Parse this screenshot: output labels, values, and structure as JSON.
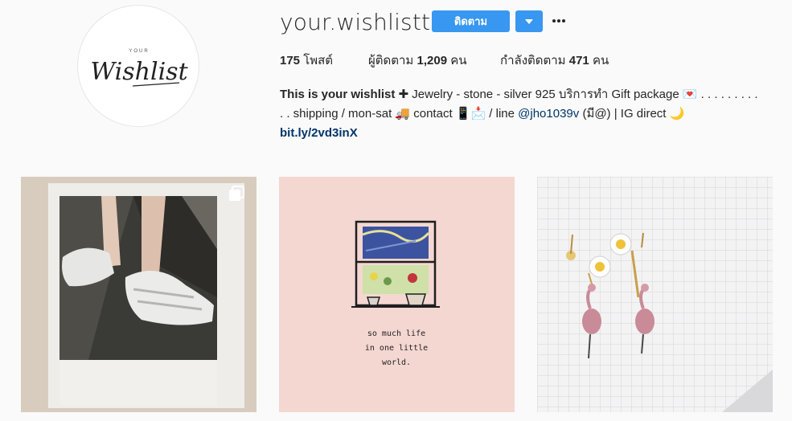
{
  "profile": {
    "username": "your.wishlistt",
    "avatar_text_small": "YOUR",
    "avatar_text_large": "Wishlist",
    "follow_label": "ติดตาม",
    "dropdown_icon": "caret-down-icon",
    "more_icon": "ellipsis-icon"
  },
  "stats": {
    "posts_count": "175",
    "posts_label": "โพสต์",
    "followers_label": "ผู้ติดตาม",
    "followers_count": "1,209",
    "followers_unit": "คน",
    "following_label": "กำลังติดตาม",
    "following_count": "471",
    "following_unit": "คน"
  },
  "bio": {
    "name": "This is your wishlist",
    "line1_rest": " ✚ Jewelry - stone - silver 925 บริการทำ Gift package 💌 . . . . . . . . .",
    "line2_pre": ". . shipping / mon-sat 🚚 contact 📱📩 / line ",
    "mention": "@jho1039v",
    "line2_post": " (มี@) | IG direct 🌙",
    "link": "bit.ly/2vd3inX"
  },
  "posts": [
    {
      "caption": "",
      "multi_icon": "carousel-icon"
    },
    {
      "caption_lines": [
        "so much life",
        "in one little",
        "world."
      ]
    },
    {
      "caption": ""
    }
  ]
}
